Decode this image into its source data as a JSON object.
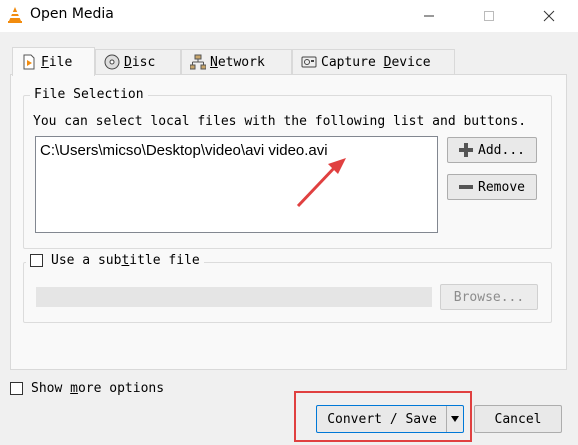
{
  "window": {
    "title": "Open Media",
    "controls": {
      "minimize": "minimize",
      "maximize": "maximize",
      "close": "close"
    }
  },
  "tabs": [
    {
      "prefix": "",
      "underline": "F",
      "rest": "ile",
      "icon": "file-play-icon",
      "active": true
    },
    {
      "prefix": "",
      "underline": "D",
      "rest": "isc",
      "icon": "disc-icon",
      "active": false
    },
    {
      "prefix": "",
      "underline": "N",
      "rest": "etwork",
      "icon": "network-icon",
      "active": false
    },
    {
      "prefix": "Capture ",
      "underline": "D",
      "rest": "evice",
      "icon": "capture-device-icon",
      "active": false
    }
  ],
  "file_selection": {
    "legend": "File Selection",
    "description": "You can select local files with the following list and buttons.",
    "files": [
      "C:\\Users\\micso\\Desktop\\video\\avi video.avi"
    ],
    "add_label": "Add...",
    "remove_label": "Remove"
  },
  "subtitle": {
    "label": "Use a subtitle file",
    "label_underline_index": 10,
    "checked": false,
    "path_value": "",
    "browse_label": "Browse..."
  },
  "footer": {
    "show_more_label": "Show more options",
    "show_more_checked": false,
    "convert_label": "Convert / Save",
    "cancel_label": "Cancel"
  },
  "colors": {
    "annotation_red": "#e04040",
    "vlc_orange": "#f28c0f",
    "focus_blue": "#0078d7"
  }
}
